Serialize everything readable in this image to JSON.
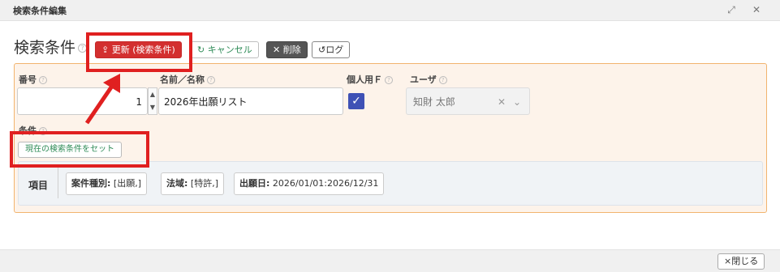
{
  "window": {
    "title": "検索条件編集",
    "restore_icon": "restore-icon",
    "close_icon": "close-icon"
  },
  "header": {
    "title": "検索条件",
    "help_glyph": "?"
  },
  "toolbar": {
    "update_label": "更新 (検索条件)",
    "update_icon": "upload-icon",
    "cancel_label": "キャンセル",
    "cancel_icon": "refresh-icon",
    "delete_label": "削除",
    "delete_icon": "x-icon",
    "log_label": "ログ",
    "log_icon": "history-icon",
    "update_color": "#d32f2f"
  },
  "form": {
    "number_label": "番号",
    "number_value": "1",
    "name_label": "名前／名称",
    "name_value": "2026年出願リスト",
    "personal_label": "個人用Ｆ",
    "personal_checked": true,
    "user_label": "ユーザ",
    "user_value": "知財 太郎",
    "condition_label": "条件",
    "set_condition_label": "現在の検索条件をセット"
  },
  "items": {
    "label": "項目",
    "chips": [
      {
        "label": "案件種別:",
        "value": "[出願,]"
      },
      {
        "label": "法域:",
        "value": "[特許,]"
      },
      {
        "label": "出願日:",
        "value": "2026/01/01:2026/12/31"
      }
    ]
  },
  "footer": {
    "close_label": "×閉じる"
  },
  "colors": {
    "panel_bg": "#fdf3ea",
    "panel_border": "#f2b46e",
    "annotation": "#e02020",
    "checkbox": "#3f51b5"
  }
}
